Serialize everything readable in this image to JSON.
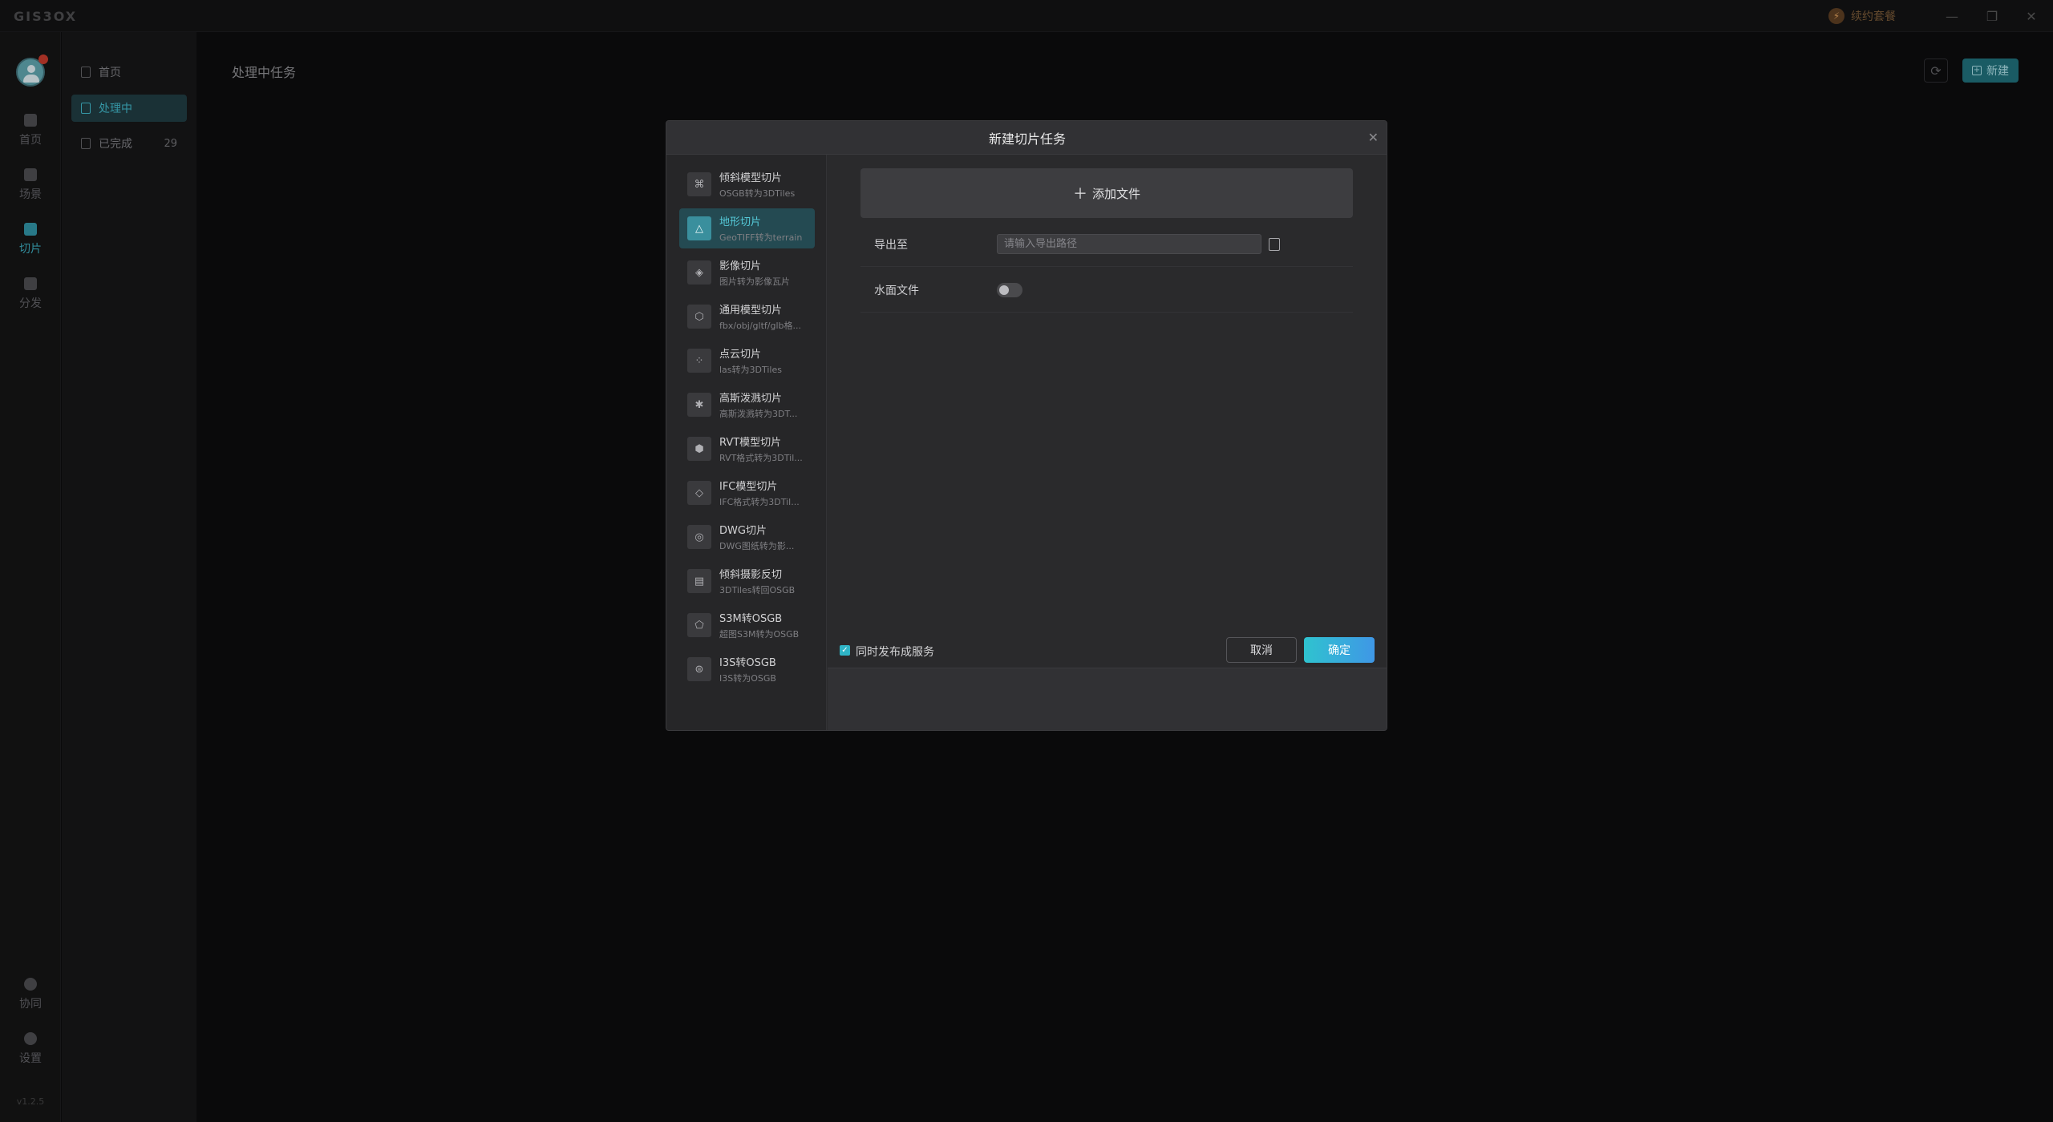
{
  "app": {
    "logo": "GIS3OX",
    "plan_label": "续约套餐",
    "window_controls": [
      "minimize-icon",
      "restore-icon",
      "close-icon"
    ]
  },
  "rail": {
    "items": [
      {
        "label": "首页",
        "icon": "home-icon"
      },
      {
        "label": "场景",
        "icon": "scene-icon"
      },
      {
        "label": "切片",
        "icon": "slice-icon"
      },
      {
        "label": "分发",
        "icon": "distribute-icon"
      }
    ],
    "bottom_items": [
      {
        "label": "协同",
        "icon": "collaborate-icon"
      },
      {
        "label": "设置",
        "icon": "settings-icon"
      }
    ],
    "version": "v1.2.5"
  },
  "sidebar": {
    "items": [
      {
        "label": "首页",
        "count": ""
      },
      {
        "label": "处理中",
        "count": ""
      },
      {
        "label": "已完成",
        "count": "29"
      }
    ]
  },
  "main": {
    "title": "处理中任务",
    "new_label": "新建"
  },
  "dialog": {
    "title": "新建切片任务",
    "types": [
      {
        "name": "倾斜模型切片",
        "desc": "OSGB转为3DTiles",
        "icon": "tilt-model-icon"
      },
      {
        "name": "地形切片",
        "desc": "GeoTIFF转为terrain",
        "icon": "terrain-icon"
      },
      {
        "name": "影像切片",
        "desc": "图片转为影像瓦片",
        "icon": "imagery-icon"
      },
      {
        "name": "通用模型切片",
        "desc": "fbx/obj/gltf/glb格...",
        "icon": "cube-icon"
      },
      {
        "name": "点云切片",
        "desc": "las转为3DTiles",
        "icon": "point-cloud-icon"
      },
      {
        "name": "高斯泼溅切片",
        "desc": "高斯泼溅转为3DT...",
        "icon": "gaussian-icon"
      },
      {
        "name": "RVT模型切片",
        "desc": "RVT格式转为3DTil...",
        "icon": "rvt-icon"
      },
      {
        "name": "IFC模型切片",
        "desc": "IFC格式转为3DTil...",
        "icon": "ifc-icon"
      },
      {
        "name": "DWG切片",
        "desc": "DWG图纸转为影...",
        "icon": "dwg-icon"
      },
      {
        "name": "倾斜摄影反切",
        "desc": "3DTiles转回OSGB",
        "icon": "reverse-icon"
      },
      {
        "name": "S3M转OSGB",
        "desc": "超图S3M转为OSGB",
        "icon": "s3m-icon"
      },
      {
        "name": "I3S转OSGB",
        "desc": "I3S转为OSGB",
        "icon": "i3s-icon"
      }
    ],
    "selected_index": 1,
    "add_file_label": "添加文件",
    "export_label": "导出至",
    "export_placeholder": "请输入导出路径",
    "water_label": "水面文件",
    "water_enabled": false,
    "publish_label": "同时发布成服务",
    "publish_checked": true,
    "cancel_label": "取消",
    "confirm_label": "确定"
  },
  "colors": {
    "accent": "#2fb4c6",
    "confirm_gradient_start": "#2fc3cf",
    "confirm_gradient_end": "#3f97e6",
    "plan": "#c8874d"
  }
}
